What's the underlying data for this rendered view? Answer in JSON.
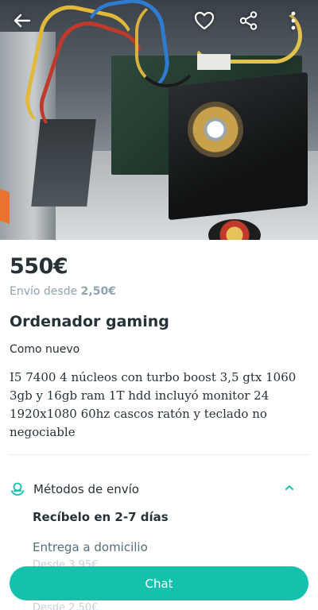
{
  "listing": {
    "price": "550€",
    "shipping_prefix": "Envío desde",
    "shipping_price": "2,50€",
    "title": "Ordenador gaming",
    "condition": "Como nuevo",
    "description": "I5 7400 4 núcleos con turbo boost 3,5 gtx 1060 3gb y 16gb ram 1T hdd incluyó monitor 24 1920x1080 60hz cascos ratón y teclado no negociable"
  },
  "shipping_methods": {
    "label": "Métodos de envío",
    "delivery_window": "Recíbelo en 2-7 días",
    "option_label": "Entrega a domicilio",
    "option_price": "Desde 3,95€",
    "next_line": "Desde 2,50€"
  },
  "cta": {
    "chat_label": "Chat"
  },
  "icons": {
    "back": "arrow-left-icon",
    "favorite": "heart-icon",
    "share": "share-icon",
    "more": "more-vertical-icon",
    "shipping": "delivery-icon",
    "expand": "chevron-up-icon"
  },
  "colors": {
    "accent": "#13c1ac",
    "text": "#253238",
    "muted": "#90a4ae"
  }
}
